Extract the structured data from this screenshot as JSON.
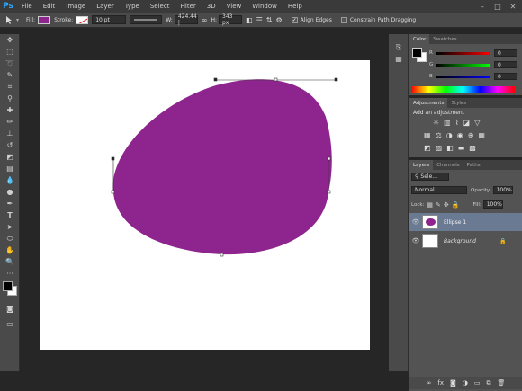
{
  "app": {
    "logo": "Ps"
  },
  "menu": [
    "File",
    "Edit",
    "Image",
    "Layer",
    "Type",
    "Select",
    "Filter",
    "3D",
    "View",
    "Window",
    "Help"
  ],
  "window_controls": [
    "–",
    "□",
    "✕"
  ],
  "options": {
    "fill_label": "Fill:",
    "stroke_label": "Stroke:",
    "stroke_width": "10 pt",
    "w_label": "W:",
    "w_value": "424.44 |",
    "h_label": "H:",
    "h_value": "343 px",
    "align_edges": "Align Edges",
    "constrain": "Constrain Path Dragging",
    "fill_color": "#8e248d"
  },
  "color_panel": {
    "tabs": [
      "Color",
      "Swatches"
    ],
    "channels": [
      {
        "label": "R",
        "value": "0"
      },
      {
        "label": "G",
        "value": "0"
      },
      {
        "label": "B",
        "value": "0"
      }
    ]
  },
  "adjustments_panel": {
    "tabs": [
      "Adjustments",
      "Styles"
    ],
    "heading": "Add an adjustment"
  },
  "layers_panel": {
    "tabs": [
      "Layers",
      "Channels",
      "Paths"
    ],
    "filter": "Sele...",
    "blend_mode": "Normal",
    "opacity_label": "Opacity:",
    "opacity_value": "100%",
    "lock_label": "Lock:",
    "fill_label": "Fill:",
    "fill_value": "100%",
    "layers": [
      {
        "name": "Ellipse 1",
        "selected": true
      },
      {
        "name": "Background",
        "selected": false
      }
    ],
    "footer_icons": [
      "link-icon",
      "fx-icon",
      "mask-icon",
      "adjustment-icon",
      "folder-icon",
      "new-layer-icon",
      "trash-icon"
    ]
  },
  "shape_color": "#8e248d"
}
